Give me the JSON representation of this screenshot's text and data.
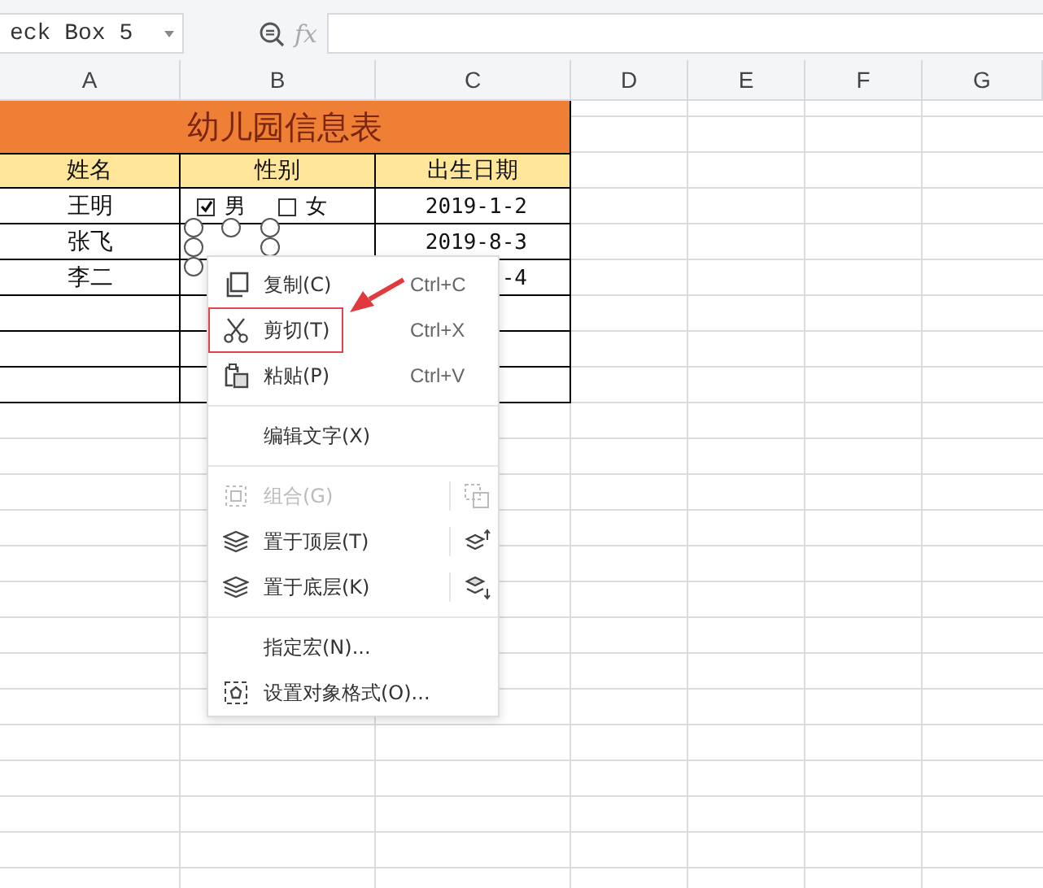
{
  "name_box": {
    "value": "eck Box 5"
  },
  "formula_bar": {
    "fx_label": "fx"
  },
  "columns": [
    "A",
    "B",
    "C",
    "D",
    "E",
    "F",
    "G"
  ],
  "sheet": {
    "title": "幼儿园信息表",
    "headers": [
      "姓名",
      "性别",
      "出生日期"
    ],
    "rows": [
      {
        "name": "王明",
        "gender_options": [
          {
            "label": "男",
            "checked": true
          },
          {
            "label": "女",
            "checked": false
          }
        ],
        "birth_date": "2019-1-2"
      },
      {
        "name": "张飞",
        "birth_date": "2019-8-3"
      },
      {
        "name": "李二",
        "birth_date": "-4"
      }
    ]
  },
  "context_menu": {
    "items": [
      {
        "kind": "item",
        "label": "复制(C)",
        "shortcut": "Ctrl+C",
        "disabled": false,
        "marked": false
      },
      {
        "kind": "item",
        "label": "剪切(T)",
        "shortcut": "Ctrl+X",
        "disabled": false,
        "marked": true
      },
      {
        "kind": "item",
        "label": "粘贴(P)",
        "shortcut": "Ctrl+V",
        "disabled": false,
        "marked": false
      },
      {
        "kind": "separator"
      },
      {
        "kind": "item",
        "label": "编辑文字(X)",
        "disabled": false,
        "marked": false
      },
      {
        "kind": "separator"
      },
      {
        "kind": "item",
        "label": "组合(G)",
        "disabled": true,
        "marked": false
      },
      {
        "kind": "item",
        "label": "置于顶层(T)",
        "disabled": false,
        "marked": false
      },
      {
        "kind": "item",
        "label": "置于底层(K)",
        "disabled": false,
        "marked": false
      },
      {
        "kind": "separator"
      },
      {
        "kind": "item",
        "label": "指定宏(N)...",
        "disabled": false,
        "marked": false
      },
      {
        "kind": "item",
        "label": "设置对象格式(O)...",
        "disabled": false,
        "marked": false
      }
    ]
  },
  "annotation_arrow": {
    "shown": true
  }
}
